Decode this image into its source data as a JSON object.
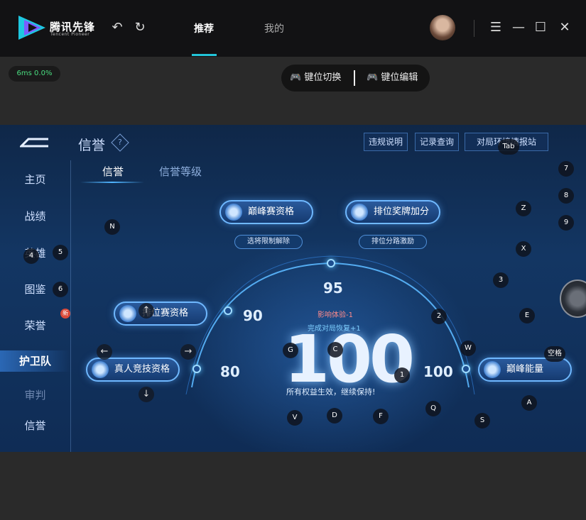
{
  "titlebar": {
    "app_name": "腾讯先锋",
    "app_sub": "Tencent Pioneer",
    "tabs": [
      {
        "label": "推荐",
        "active": true
      },
      {
        "label": "我的",
        "active": false
      }
    ],
    "icons": {
      "undo": "undo-icon",
      "refresh": "refresh-icon",
      "menu": "menu-icon",
      "minimize": "minimize-icon",
      "maximize": "maximize-icon",
      "close": "close-icon"
    },
    "accent": "#22c4d8"
  },
  "ping": {
    "text": "6ms  0.0%"
  },
  "keybar": {
    "switch_label": "键位切换",
    "edit_label": "键位编辑"
  },
  "game": {
    "title": "信誉",
    "help_glyph": "?",
    "top_buttons": [
      "违规说明",
      "记录查询",
      "对局环境情报站"
    ],
    "sidebar": [
      {
        "label": "主页"
      },
      {
        "label": "战绩"
      },
      {
        "label": "英雄"
      },
      {
        "label": "图鉴"
      },
      {
        "label": "荣誉"
      },
      {
        "label": "护卫队"
      },
      {
        "label": "审判"
      },
      {
        "label": "信誉"
      }
    ],
    "new_badge": "新",
    "subtabs": [
      {
        "label": "信誉",
        "active": true
      },
      {
        "label": "信誉等级",
        "active": false
      }
    ],
    "pills": {
      "peak_qual": "巅峰赛资格",
      "rank_medal": "排位奖牌加分",
      "rank_qual": "排位赛资格",
      "real_qual": "真人竞技资格",
      "peak_energy": "巅峰能量"
    },
    "sub_pills": {
      "hero_limit": "选将限制解除",
      "lane_bonus": "排位分路激励"
    },
    "score": {
      "value": "100",
      "mark_95": "95",
      "mark_90": "90",
      "mark_80": "80",
      "mark_100": "100",
      "effect_line1": "影响体验-1",
      "effect_line2": "完成对局恢复+1",
      "rights": "所有权益生效，继续保持!"
    },
    "keys": {
      "tab": "Tab",
      "k7": "7",
      "k8": "8",
      "k9": "9",
      "z": "Z",
      "n": "N",
      "k5": "5",
      "k4": "4",
      "k6": "6",
      "x": "X",
      "k3": "3",
      "e": "E",
      "k2": "2",
      "w": "W",
      "space": "空格",
      "g": "G",
      "c": "C",
      "k1": "1",
      "q": "Q",
      "a": "A",
      "s": "S",
      "v": "V",
      "d": "D",
      "f": "F"
    }
  }
}
